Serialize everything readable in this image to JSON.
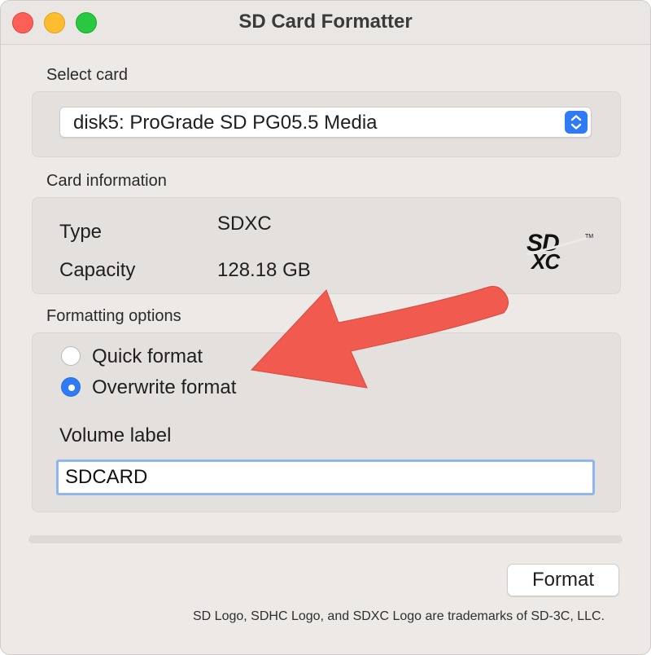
{
  "window": {
    "title": "SD Card Formatter"
  },
  "select_card": {
    "label": "Select card",
    "selected": "disk5: ProGrade SD PG05.5 Media"
  },
  "card_information": {
    "label": "Card information",
    "type_key": "Type",
    "type_value": "SDXC",
    "capacity_key": "Capacity",
    "capacity_value": "128.18 GB",
    "logo_icon": "sdxc-logo-icon"
  },
  "formatting_options": {
    "label": "Formatting options",
    "options": [
      {
        "label": "Quick format",
        "selected": false
      },
      {
        "label": "Overwrite format",
        "selected": true
      }
    ],
    "volume_label": "Volume label",
    "volume_value": "SDCARD"
  },
  "progress": {
    "value": 0
  },
  "actions": {
    "format_label": "Format"
  },
  "footer": {
    "text": "SD Logo, SDHC Logo, and SDXC Logo are trademarks of SD-3C, LLC."
  },
  "colors": {
    "accent": "#2f7bf6",
    "annotation_arrow": "#f05a4f",
    "close": "#fe5f57",
    "minimize": "#febc2e",
    "maximize": "#28c840"
  }
}
